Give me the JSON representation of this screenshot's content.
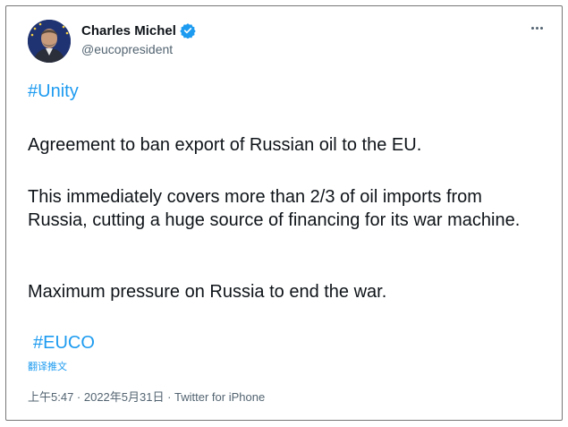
{
  "author": {
    "display_name": "Charles Michel",
    "handle": "@eucopresident"
  },
  "icons": {
    "verified": "verified-badge-icon",
    "more": "more-options-icon"
  },
  "tweet": {
    "hashtag_top": "#Unity",
    "line1": "Agreement to ban export of Russian oil to the EU.",
    "line2": "This immediately covers more than 2/3 of oil imports from Russia, cutting a huge source of financing for its war machine.",
    "line3": "Maximum pressure on Russia to end the war.",
    "hashtag_bottom": "#EUCO"
  },
  "translate_label": "翻译推文",
  "meta": {
    "time_date": "上午5:47 · 2022年5月31日 · ",
    "source": "Twitter for iPhone"
  },
  "colors": {
    "link": "#1d9bf0",
    "secondary": "#536471",
    "text": "#0f1419"
  }
}
